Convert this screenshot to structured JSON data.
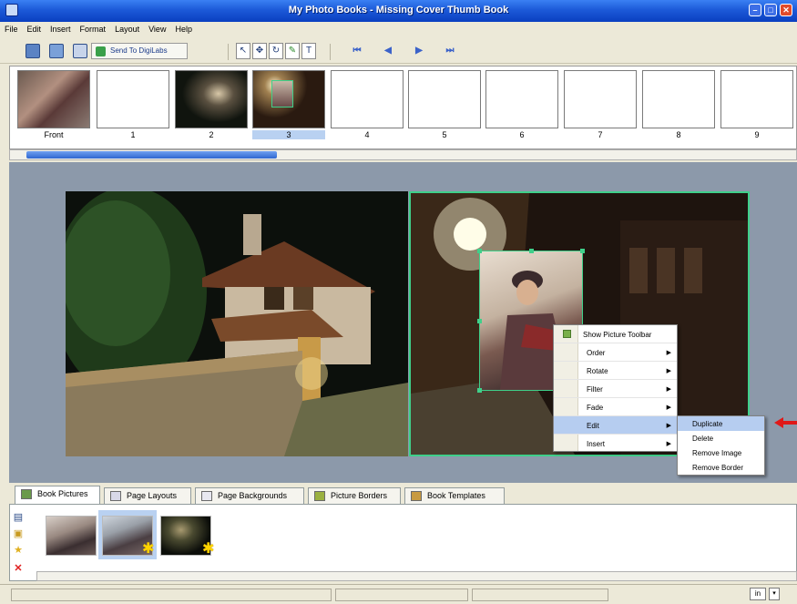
{
  "window": {
    "title": "My Photo Books - Missing Cover Thumb Book",
    "controls": [
      "minimize-icon",
      "maximize-icon",
      "close-icon"
    ]
  },
  "menu": [
    "File",
    "Edit",
    "Insert",
    "Format",
    "Layout",
    "View",
    "Help"
  ],
  "toolbar": {
    "send_label": "Send To DigiLabs"
  },
  "thumbnails": {
    "labels": [
      "Front",
      "1",
      "2",
      "3",
      "4",
      "5",
      "6",
      "7",
      "8",
      "9"
    ],
    "selected": "3"
  },
  "context_menu": {
    "items": [
      "Show Picture Toolbar",
      "Order",
      "Rotate",
      "Filter",
      "Fade",
      "Edit",
      "Insert"
    ],
    "highlighted": "Edit",
    "submenu": [
      "Duplicate",
      "Delete",
      "Remove Image",
      "Remove Border"
    ],
    "submenu_highlighted": "Duplicate"
  },
  "tabs": [
    "Book Pictures",
    "Page Layouts",
    "Page Backgrounds",
    "Picture Borders",
    "Book Templates"
  ],
  "active_tab": "Book Pictures",
  "status": {
    "unit": "in"
  },
  "colors": {
    "titlebar": "#1c5ad8",
    "selection": "#b9d1f1",
    "canvas": "#8c99aa",
    "frame_highlight": "#3fd08a",
    "arrow": "#e01818"
  }
}
